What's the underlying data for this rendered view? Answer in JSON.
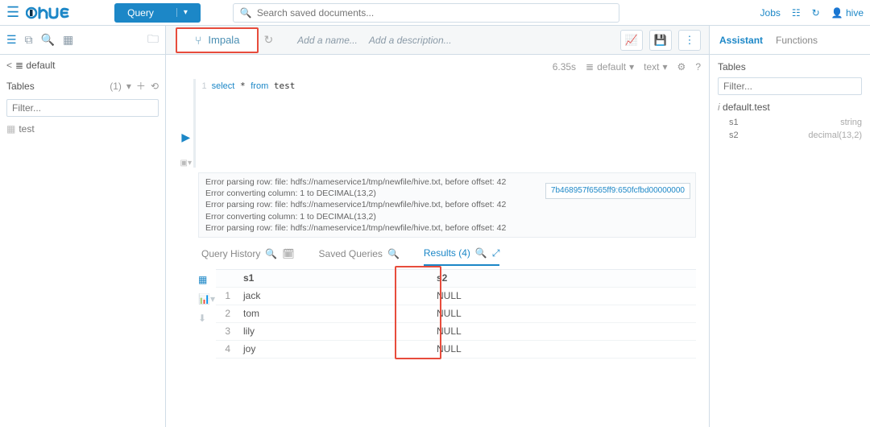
{
  "top": {
    "query_btn": "Query",
    "search_placeholder": "Search saved documents...",
    "jobs": "Jobs",
    "user": "hive"
  },
  "left": {
    "db": "default",
    "tables_label": "Tables",
    "tables_count": "(1)",
    "filter_placeholder": "Filter...",
    "table": "test"
  },
  "editor": {
    "engine": "Impala",
    "add_name": "Add a name...",
    "add_desc": "Add a description...",
    "elapsed": "6.35s",
    "db": "default",
    "format": "text",
    "sql": "select * from test"
  },
  "log_lines": [
    "Error parsing row: file: hdfs://nameservice1/tmp/newfile/hive.txt, before offset: 42",
    "Error converting column: 1 to DECIMAL(13,2)",
    "Error parsing row: file: hdfs://nameservice1/tmp/newfile/hive.txt, before offset: 42",
    "Error converting column: 1 to DECIMAL(13,2)",
    "Error parsing row: file: hdfs://nameservice1/tmp/newfile/hive.txt, before offset: 42"
  ],
  "tooltip": "7b468957f6565ff9:650fcfbd00000000",
  "tabs": {
    "history": "Query History",
    "saved": "Saved Queries",
    "results": "Results (4)"
  },
  "results": {
    "cols": [
      "",
      "s1",
      "s2"
    ],
    "rows": [
      {
        "idx": "1",
        "s1": "jack",
        "s2": "NULL"
      },
      {
        "idx": "2",
        "s1": "tom",
        "s2": "NULL"
      },
      {
        "idx": "3",
        "s1": "lily",
        "s2": "NULL"
      },
      {
        "idx": "4",
        "s1": "joy",
        "s2": "NULL"
      }
    ]
  },
  "right": {
    "assistant": "Assistant",
    "functions": "Functions",
    "tables": "Tables",
    "filter_placeholder": "Filter...",
    "table_full": "default.test",
    "cols": [
      {
        "name": "s1",
        "type": "string"
      },
      {
        "name": "s2",
        "type": "decimal(13,2)"
      }
    ]
  }
}
